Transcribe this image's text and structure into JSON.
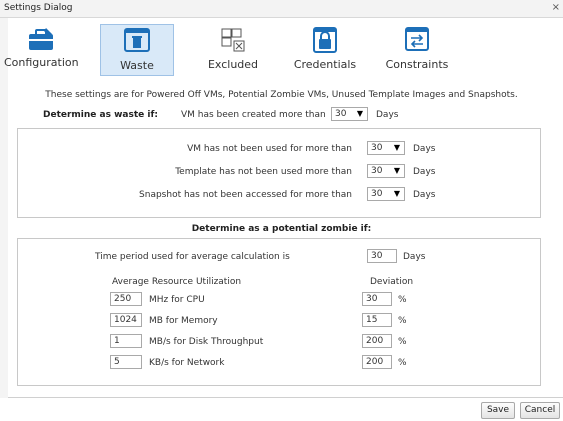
{
  "window": {
    "title": "Settings Dialog",
    "close_label": "×"
  },
  "toolbar": {
    "configuration": "Configuration",
    "waste": "Waste",
    "excluded": "Excluded",
    "credentials": "Credentials",
    "constraints": "Constraints",
    "selected": "Waste"
  },
  "info_text": "These settings are for Powered Off VMs, Potential Zombie VMs, Unused Template Images and Snapshots.",
  "waste": {
    "heading": "Determine as waste if:",
    "created_label": "VM has been created more than",
    "created_value": "30",
    "created_unit": "Days",
    "rules": [
      {
        "label": "VM has not been used for more than",
        "value": "30",
        "unit": "Days"
      },
      {
        "label": "Template has not been used more than",
        "value": "30",
        "unit": "Days"
      },
      {
        "label": "Snapshot has not been accessed for more than",
        "value": "30",
        "unit": "Days"
      }
    ]
  },
  "zombie": {
    "heading": "Determine as a potential zombie if:",
    "period_label": "Time period used for average calculation is",
    "period_value": "30",
    "period_unit": "Days",
    "avg_header": "Average Resource Utilization",
    "dev_header": "Deviation",
    "rows": [
      {
        "value": "250",
        "label": "MHz for CPU",
        "deviation": "30",
        "pct": "%"
      },
      {
        "value": "1024",
        "label": "MB for Memory",
        "deviation": "15",
        "pct": "%"
      },
      {
        "value": "1",
        "label": "MB/s for Disk Throughput",
        "deviation": "200",
        "pct": "%"
      },
      {
        "value": "5",
        "label": "KB/s for Network",
        "deviation": "200",
        "pct": "%"
      }
    ]
  },
  "buttons": {
    "save": "Save",
    "cancel": "Cancel"
  },
  "colors": {
    "icon_blue": "#1d6fb8",
    "selected_bg": "#d9e9f8",
    "selected_border": "#9fc2e6"
  }
}
